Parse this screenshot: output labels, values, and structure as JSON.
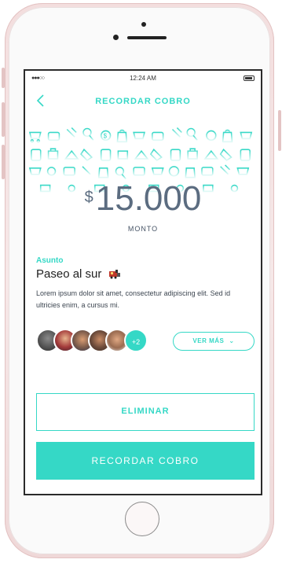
{
  "status_bar": {
    "signal": "●●●○○",
    "time": "12:24 AM"
  },
  "nav": {
    "title": "RECORDAR COBRO"
  },
  "amount": {
    "currency_symbol": "$",
    "value": "15.000",
    "label": "MONTO"
  },
  "subject": {
    "label": "Asunto",
    "title": "Paseo al sur",
    "description": "Lorem ipsum dolor sit amet, consectetur adipiscing elit. Sed id ultricies enim, a cursus mi."
  },
  "participants": {
    "extra_count": "+2",
    "view_more": "VER MÁS"
  },
  "actions": {
    "delete": "ELIMINAR",
    "remind": "RECORDAR COBRO"
  },
  "colors": {
    "accent": "#35d8c6",
    "amount_text": "#5b6c80",
    "phone_frame": "#f3dede"
  },
  "icons": [
    "back-chevron-icon",
    "shopping-pattern-icons",
    "train-emoji-icon",
    "chevron-down-icon",
    "battery-icon"
  ]
}
